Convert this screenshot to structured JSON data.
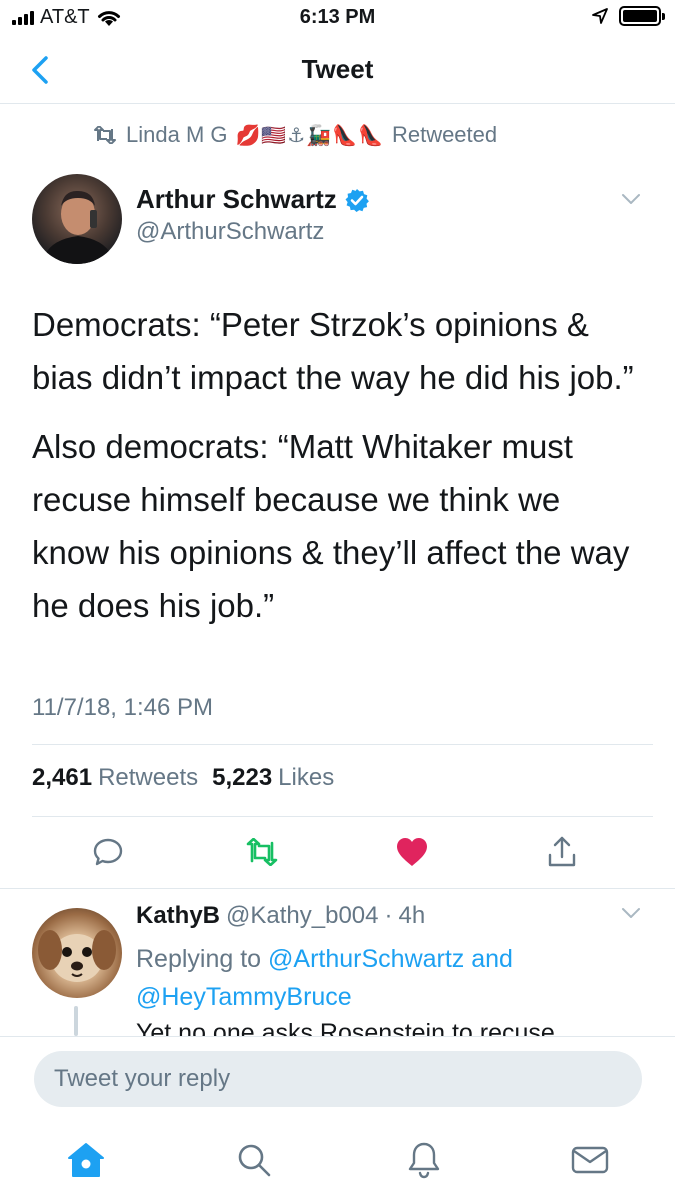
{
  "status_bar": {
    "carrier": "AT&T",
    "time": "6:13 PM"
  },
  "nav": {
    "title": "Tweet",
    "back_icon": "chevron-left-icon"
  },
  "retweeted_by": {
    "name": "Linda M G",
    "emojis": "💋🇺🇸⚓🚂👠👠",
    "label": "Retweeted"
  },
  "tweet": {
    "author_name": "Arthur Schwartz",
    "author_handle": "@ArthurSchwartz",
    "verified": true,
    "paragraphs": [
      "Democrats: “Peter Strzok’s opinions & bias didn’t impact the way he did his job.”",
      "Also democrats: “Matt Whitaker must recuse himself because we think we know his opinions & they’ll affect the way he does his job.”"
    ],
    "timestamp": "11/7/18, 1:46 PM",
    "retweets_count": "2,461",
    "retweets_label": "Retweets",
    "likes_count": "5,223",
    "likes_label": "Likes",
    "liked": true
  },
  "reply": {
    "name": "KathyB",
    "handle": "@Kathy_b004",
    "separator": "·",
    "age": "4h",
    "replying_prefix": "Replying to",
    "replying_to_1": "@ArthurSchwartz",
    "replying_and": "and",
    "replying_to_2": "@HeyTammyBruce",
    "text": "Yet no one asks Rosenstein to recuse"
  },
  "composer": {
    "placeholder": "Tweet your reply"
  },
  "tabs": [
    "home-icon",
    "search-icon",
    "notifications-icon",
    "messages-icon"
  ],
  "colors": {
    "accent": "#1da1f2",
    "like": "#e0245e",
    "retweet": "#17bf63",
    "secondary_text": "#657786"
  }
}
